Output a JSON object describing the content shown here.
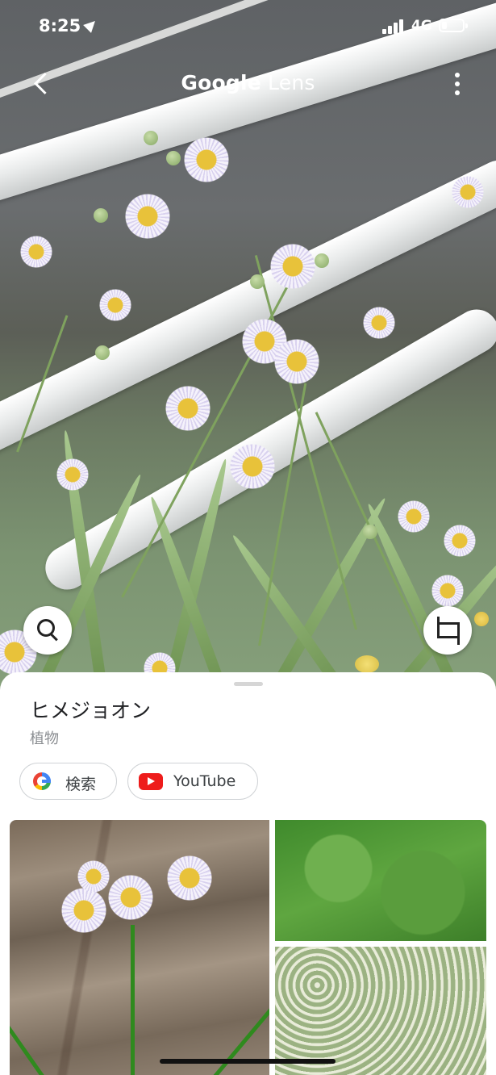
{
  "status_bar": {
    "time": "8:25",
    "network": "4G"
  },
  "top_bar": {
    "title_brand": "Google",
    "title_product": "Lens",
    "back_icon": "back-arrow-icon",
    "more_icon": "more-vertical-icon"
  },
  "photo": {
    "subject": "flowers",
    "search_icon": "search-icon",
    "crop_icon": "crop-icon"
  },
  "result": {
    "title": "ヒメジョオン",
    "subtitle": "植物",
    "chips": [
      {
        "label": "検索",
        "icon": "google-icon"
      },
      {
        "label": "YouTube",
        "icon": "youtube-icon"
      }
    ]
  },
  "colors": {
    "youtube_red": "#ee1c1b",
    "google_blue": "#4285f4"
  }
}
